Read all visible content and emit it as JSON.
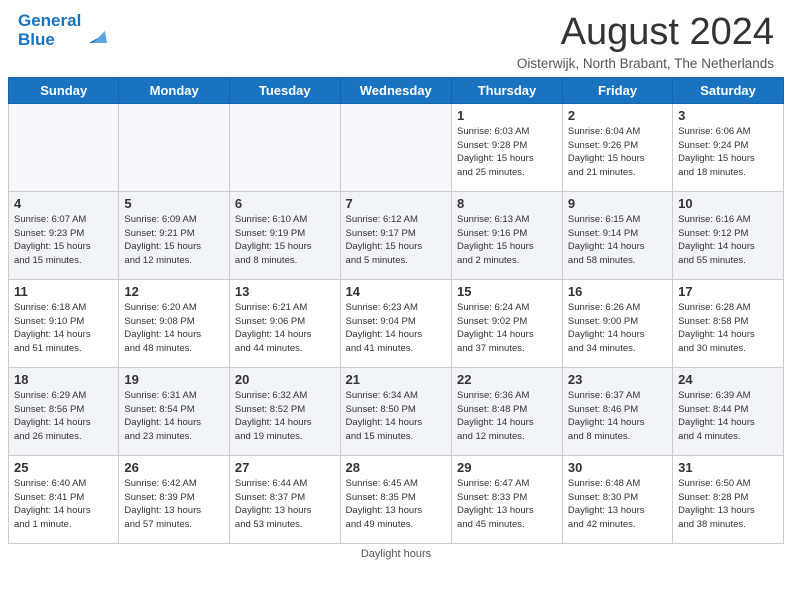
{
  "header": {
    "logo_line1": "General",
    "logo_line2": "Blue",
    "month_title": "August 2024",
    "location": "Oisterwijk, North Brabant, The Netherlands"
  },
  "days_of_week": [
    "Sunday",
    "Monday",
    "Tuesday",
    "Wednesday",
    "Thursday",
    "Friday",
    "Saturday"
  ],
  "weeks": [
    [
      {
        "day": "",
        "info": "",
        "empty": true
      },
      {
        "day": "",
        "info": "",
        "empty": true
      },
      {
        "day": "",
        "info": "",
        "empty": true
      },
      {
        "day": "",
        "info": "",
        "empty": true
      },
      {
        "day": "1",
        "info": "Sunrise: 6:03 AM\nSunset: 9:28 PM\nDaylight: 15 hours\nand 25 minutes."
      },
      {
        "day": "2",
        "info": "Sunrise: 6:04 AM\nSunset: 9:26 PM\nDaylight: 15 hours\nand 21 minutes."
      },
      {
        "day": "3",
        "info": "Sunrise: 6:06 AM\nSunset: 9:24 PM\nDaylight: 15 hours\nand 18 minutes."
      }
    ],
    [
      {
        "day": "4",
        "info": "Sunrise: 6:07 AM\nSunset: 9:23 PM\nDaylight: 15 hours\nand 15 minutes."
      },
      {
        "day": "5",
        "info": "Sunrise: 6:09 AM\nSunset: 9:21 PM\nDaylight: 15 hours\nand 12 minutes."
      },
      {
        "day": "6",
        "info": "Sunrise: 6:10 AM\nSunset: 9:19 PM\nDaylight: 15 hours\nand 8 minutes."
      },
      {
        "day": "7",
        "info": "Sunrise: 6:12 AM\nSunset: 9:17 PM\nDaylight: 15 hours\nand 5 minutes."
      },
      {
        "day": "8",
        "info": "Sunrise: 6:13 AM\nSunset: 9:16 PM\nDaylight: 15 hours\nand 2 minutes."
      },
      {
        "day": "9",
        "info": "Sunrise: 6:15 AM\nSunset: 9:14 PM\nDaylight: 14 hours\nand 58 minutes."
      },
      {
        "day": "10",
        "info": "Sunrise: 6:16 AM\nSunset: 9:12 PM\nDaylight: 14 hours\nand 55 minutes."
      }
    ],
    [
      {
        "day": "11",
        "info": "Sunrise: 6:18 AM\nSunset: 9:10 PM\nDaylight: 14 hours\nand 51 minutes."
      },
      {
        "day": "12",
        "info": "Sunrise: 6:20 AM\nSunset: 9:08 PM\nDaylight: 14 hours\nand 48 minutes."
      },
      {
        "day": "13",
        "info": "Sunrise: 6:21 AM\nSunset: 9:06 PM\nDaylight: 14 hours\nand 44 minutes."
      },
      {
        "day": "14",
        "info": "Sunrise: 6:23 AM\nSunset: 9:04 PM\nDaylight: 14 hours\nand 41 minutes."
      },
      {
        "day": "15",
        "info": "Sunrise: 6:24 AM\nSunset: 9:02 PM\nDaylight: 14 hours\nand 37 minutes."
      },
      {
        "day": "16",
        "info": "Sunrise: 6:26 AM\nSunset: 9:00 PM\nDaylight: 14 hours\nand 34 minutes."
      },
      {
        "day": "17",
        "info": "Sunrise: 6:28 AM\nSunset: 8:58 PM\nDaylight: 14 hours\nand 30 minutes."
      }
    ],
    [
      {
        "day": "18",
        "info": "Sunrise: 6:29 AM\nSunset: 8:56 PM\nDaylight: 14 hours\nand 26 minutes."
      },
      {
        "day": "19",
        "info": "Sunrise: 6:31 AM\nSunset: 8:54 PM\nDaylight: 14 hours\nand 23 minutes."
      },
      {
        "day": "20",
        "info": "Sunrise: 6:32 AM\nSunset: 8:52 PM\nDaylight: 14 hours\nand 19 minutes."
      },
      {
        "day": "21",
        "info": "Sunrise: 6:34 AM\nSunset: 8:50 PM\nDaylight: 14 hours\nand 15 minutes."
      },
      {
        "day": "22",
        "info": "Sunrise: 6:36 AM\nSunset: 8:48 PM\nDaylight: 14 hours\nand 12 minutes."
      },
      {
        "day": "23",
        "info": "Sunrise: 6:37 AM\nSunset: 8:46 PM\nDaylight: 14 hours\nand 8 minutes."
      },
      {
        "day": "24",
        "info": "Sunrise: 6:39 AM\nSunset: 8:44 PM\nDaylight: 14 hours\nand 4 minutes."
      }
    ],
    [
      {
        "day": "25",
        "info": "Sunrise: 6:40 AM\nSunset: 8:41 PM\nDaylight: 14 hours\nand 1 minute."
      },
      {
        "day": "26",
        "info": "Sunrise: 6:42 AM\nSunset: 8:39 PM\nDaylight: 13 hours\nand 57 minutes."
      },
      {
        "day": "27",
        "info": "Sunrise: 6:44 AM\nSunset: 8:37 PM\nDaylight: 13 hours\nand 53 minutes."
      },
      {
        "day": "28",
        "info": "Sunrise: 6:45 AM\nSunset: 8:35 PM\nDaylight: 13 hours\nand 49 minutes."
      },
      {
        "day": "29",
        "info": "Sunrise: 6:47 AM\nSunset: 8:33 PM\nDaylight: 13 hours\nand 45 minutes."
      },
      {
        "day": "30",
        "info": "Sunrise: 6:48 AM\nSunset: 8:30 PM\nDaylight: 13 hours\nand 42 minutes."
      },
      {
        "day": "31",
        "info": "Sunrise: 6:50 AM\nSunset: 8:28 PM\nDaylight: 13 hours\nand 38 minutes."
      }
    ]
  ],
  "footer": {
    "daylight_label": "Daylight hours"
  }
}
